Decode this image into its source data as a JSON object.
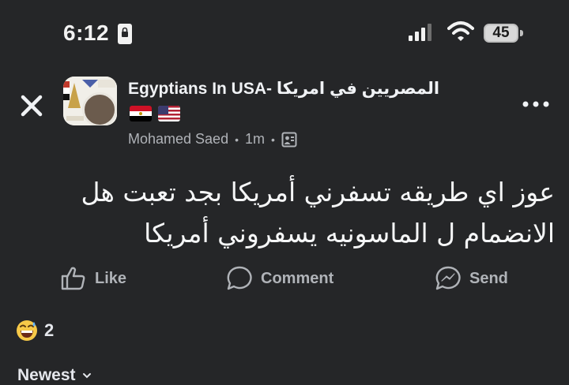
{
  "status_bar": {
    "time": "6:12",
    "battery": "45",
    "icons": [
      "portrait-lock-icon",
      "signal-icon",
      "wifi-icon",
      "battery-icon"
    ]
  },
  "header": {
    "group_name": "Egyptians In USA- المصريين في امريكا",
    "flags": [
      "egypt-flag-icon",
      "usa-flag-icon"
    ],
    "author": "Mohamed Saed",
    "time_ago": "1m",
    "privacy_icon": "group-audience-icon"
  },
  "post": {
    "text": "عوز اي طريقه تسفرني أمريكا بجد تعبت هل الانضمام ل الماسونيه يسفروني أمريكا"
  },
  "actions": {
    "like": "Like",
    "comment": "Comment",
    "send": "Send"
  },
  "reactions": {
    "emoji": "grinning-sweat-emoji",
    "count": "2"
  },
  "comments": {
    "sort_label": "Newest"
  },
  "colors": {
    "background": "#252628",
    "text": "#e4e6eb",
    "muted": "#b0b3b8"
  }
}
